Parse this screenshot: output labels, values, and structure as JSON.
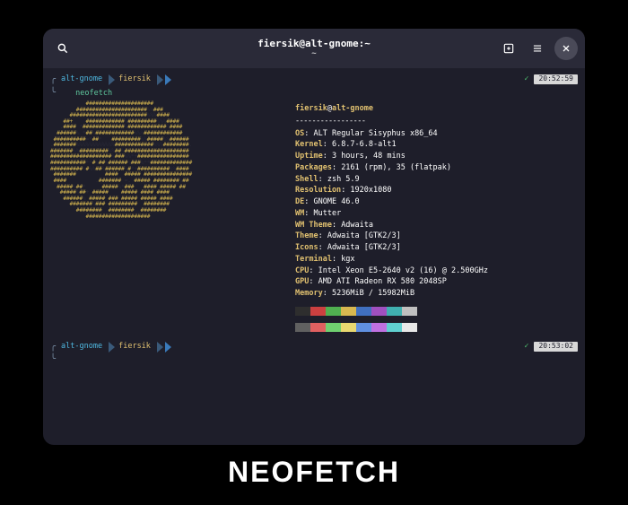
{
  "window": {
    "title": "fiersik@alt-gnome:~",
    "subtitle": "~"
  },
  "prompt1": {
    "host": "alt-gnome",
    "user": "fiersik",
    "time": "20:52:59",
    "command": "neofetch"
  },
  "prompt2": {
    "host": "alt-gnome",
    "user": "fiersik",
    "time": "20:53:02"
  },
  "neofetch": {
    "user": "fiersik",
    "host": "alt-gnome",
    "separator": "-----------------",
    "info": [
      {
        "key": "OS",
        "val": "ALT Regular Sisyphus x86_64"
      },
      {
        "key": "Kernel",
        "val": "6.8.7-6.8-alt1"
      },
      {
        "key": "Uptime",
        "val": "3 hours, 48 mins"
      },
      {
        "key": "Packages",
        "val": "2161 (rpm), 35 (flatpak)"
      },
      {
        "key": "Shell",
        "val": "zsh 5.9"
      },
      {
        "key": "Resolution",
        "val": "1920x1080"
      },
      {
        "key": "DE",
        "val": "GNOME 46.0"
      },
      {
        "key": "WM",
        "val": "Mutter"
      },
      {
        "key": "WM Theme",
        "val": "Adwaita"
      },
      {
        "key": "Theme",
        "val": "Adwaita [GTK2/3]"
      },
      {
        "key": "Icons",
        "val": "Adwaita [GTK2/3]"
      },
      {
        "key": "Terminal",
        "val": "kgx"
      },
      {
        "key": "CPU",
        "val": "Intel Xeon E5-2640 v2 (16) @ 2.500GHz"
      },
      {
        "key": "GPU",
        "val": "AMD ATI Radeon RX 580 2048SP"
      },
      {
        "key": "Memory",
        "val": "5236MiB / 15982MiB"
      }
    ],
    "colors_row1": [
      "#2e2e2e",
      "#cc4040",
      "#50b050",
      "#d8b850",
      "#4070c0",
      "#a050c0",
      "#40b0b0",
      "#c0c0c0"
    ],
    "colors_row2": [
      "#606060",
      "#e06060",
      "#70d070",
      "#e8d870",
      "#6090e0",
      "#c070e0",
      "#60d0d0",
      "#e8e8e8"
    ]
  },
  "caption": "NEOFETCH"
}
